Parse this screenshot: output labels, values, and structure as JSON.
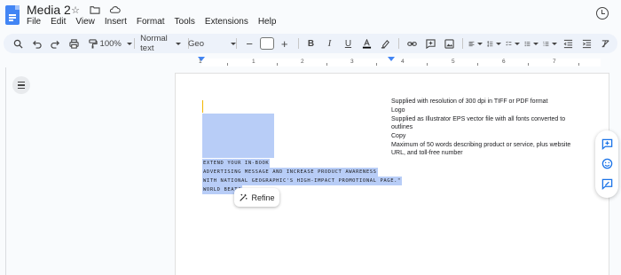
{
  "app": {
    "doc_title": "Media 2"
  },
  "menubar": {
    "items": [
      "File",
      "Edit",
      "View",
      "Insert",
      "Format",
      "Tools",
      "Extensions",
      "Help"
    ]
  },
  "toolbar": {
    "zoom": "100%",
    "style": "Normal text",
    "font": "Geo",
    "font_size": ""
  },
  "ruler": {
    "numbers": [
      "1",
      "1",
      "2",
      "3",
      "4",
      "5",
      "6",
      "7"
    ]
  },
  "document": {
    "selected_lines": [
      "EXTEND YOUR IN-BOOK",
      "ADVERTISING MESSAGE AND INCREASE PRODUCT AWARENESS",
      "WITH NATIONAL GEOGRAPHIC'S HIGH-IMPACT PROMOTIONAL PAGE.\"",
      "WORLD BEAT\""
    ],
    "right_column": [
      "Supplied with resolution of 300 dpi in TIFF or PDF format",
      "Logo",
      "Supplied as Illustrator EPS vector file with all fonts converted to outlines",
      "Copy",
      "Maximum of 50 words describing product or service, plus website URL, and toll-free number"
    ]
  },
  "refine": {
    "label": "Refine"
  },
  "colors": {
    "accent": "#4285f4",
    "selection": "#b8cdf7",
    "toolbar_bg": "#edf2fa",
    "side_icons": "#1a73e8"
  }
}
